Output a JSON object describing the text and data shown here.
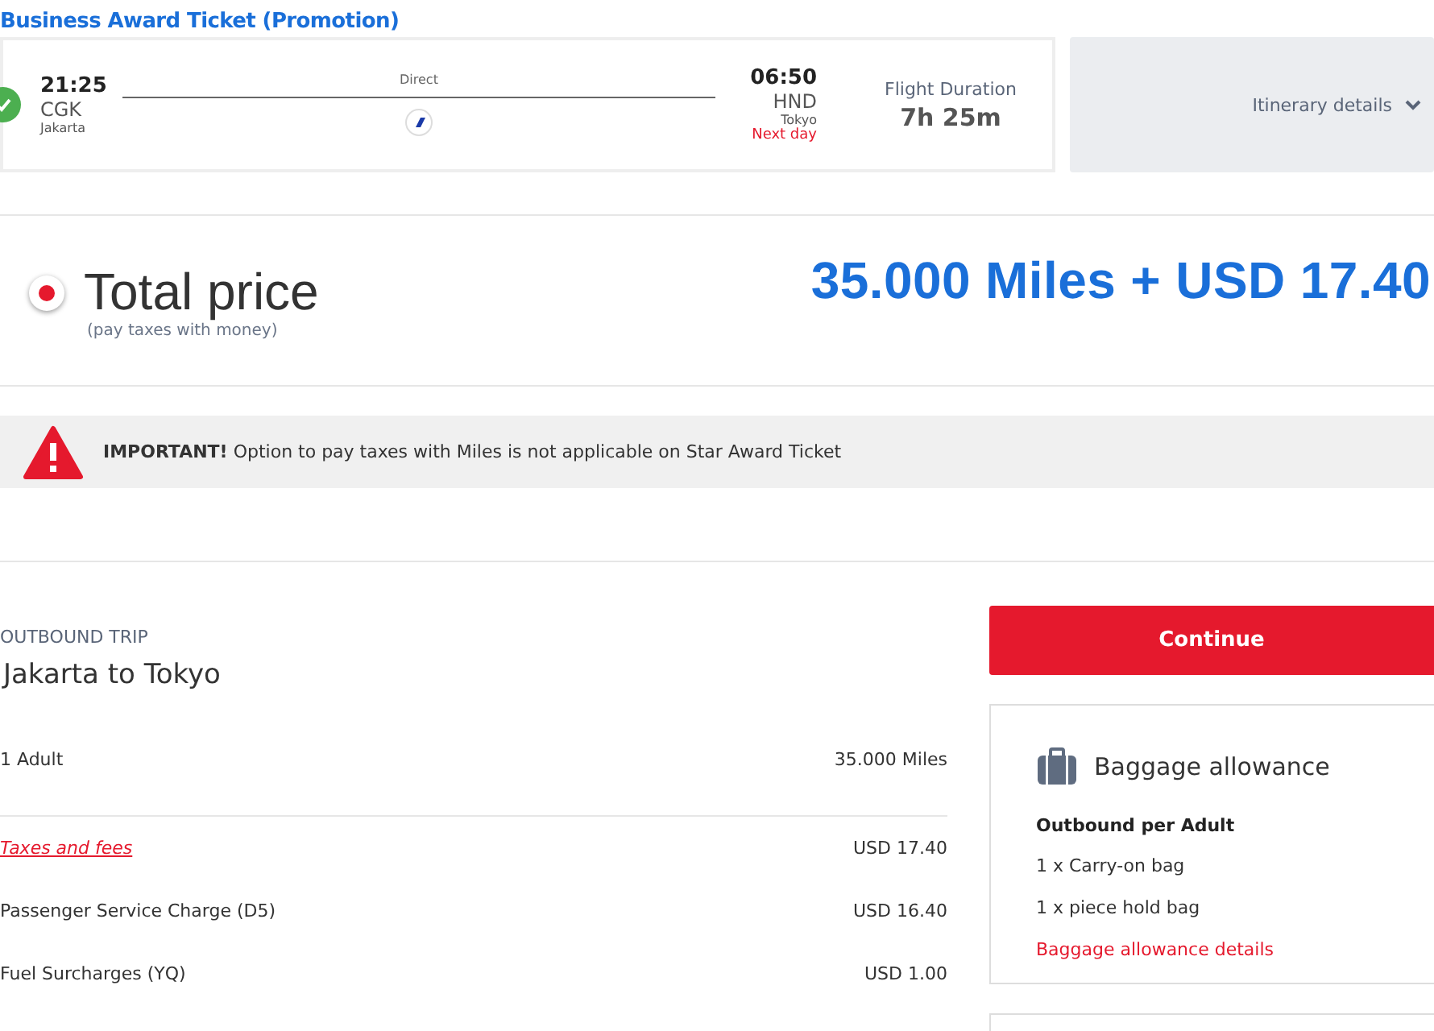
{
  "ticket_title": "Business Award Ticket (Promotion)",
  "flight": {
    "selected": true,
    "depart_time": "21:25",
    "depart_code": "CGK",
    "depart_city": "Jakarta",
    "stops": "Direct",
    "arrive_time": "06:50",
    "arrive_code": "HND",
    "arrive_city": "Tokyo",
    "next_day": "Next day",
    "duration_label": "Flight Duration",
    "duration": "7h 25m"
  },
  "itinerary_button": "Itinerary details",
  "total": {
    "selected": true,
    "label": "Total price",
    "note": "(pay taxes with money)",
    "amount": "35.000 Miles + USD 17.40"
  },
  "warning": {
    "lead": "IMPORTANT!",
    "text": "Option to pay taxes with Miles is not applicable on Star Award Ticket"
  },
  "trip": {
    "kicker": "OUTBOUND TRIP",
    "title": "Jakarta to Tokyo"
  },
  "lines": [
    {
      "kind": "plain",
      "label": "1 Adult",
      "value": "35.000 Miles"
    },
    {
      "kind": "link",
      "label": "Taxes and fees",
      "value": "USD 17.40"
    },
    {
      "kind": "plain",
      "label": "Passenger Service Charge (D5)",
      "value": "USD 16.40"
    },
    {
      "kind": "plain",
      "label": "Fuel Surcharges (YQ)",
      "value": "USD 1.00"
    }
  ],
  "continue_button": "Continue",
  "baggage": {
    "title": "Baggage allowance",
    "subtitle": "Outbound per Adult",
    "items": [
      "1 x Carry-on bag",
      "1 x piece hold bag"
    ],
    "link": "Baggage allowance details"
  }
}
